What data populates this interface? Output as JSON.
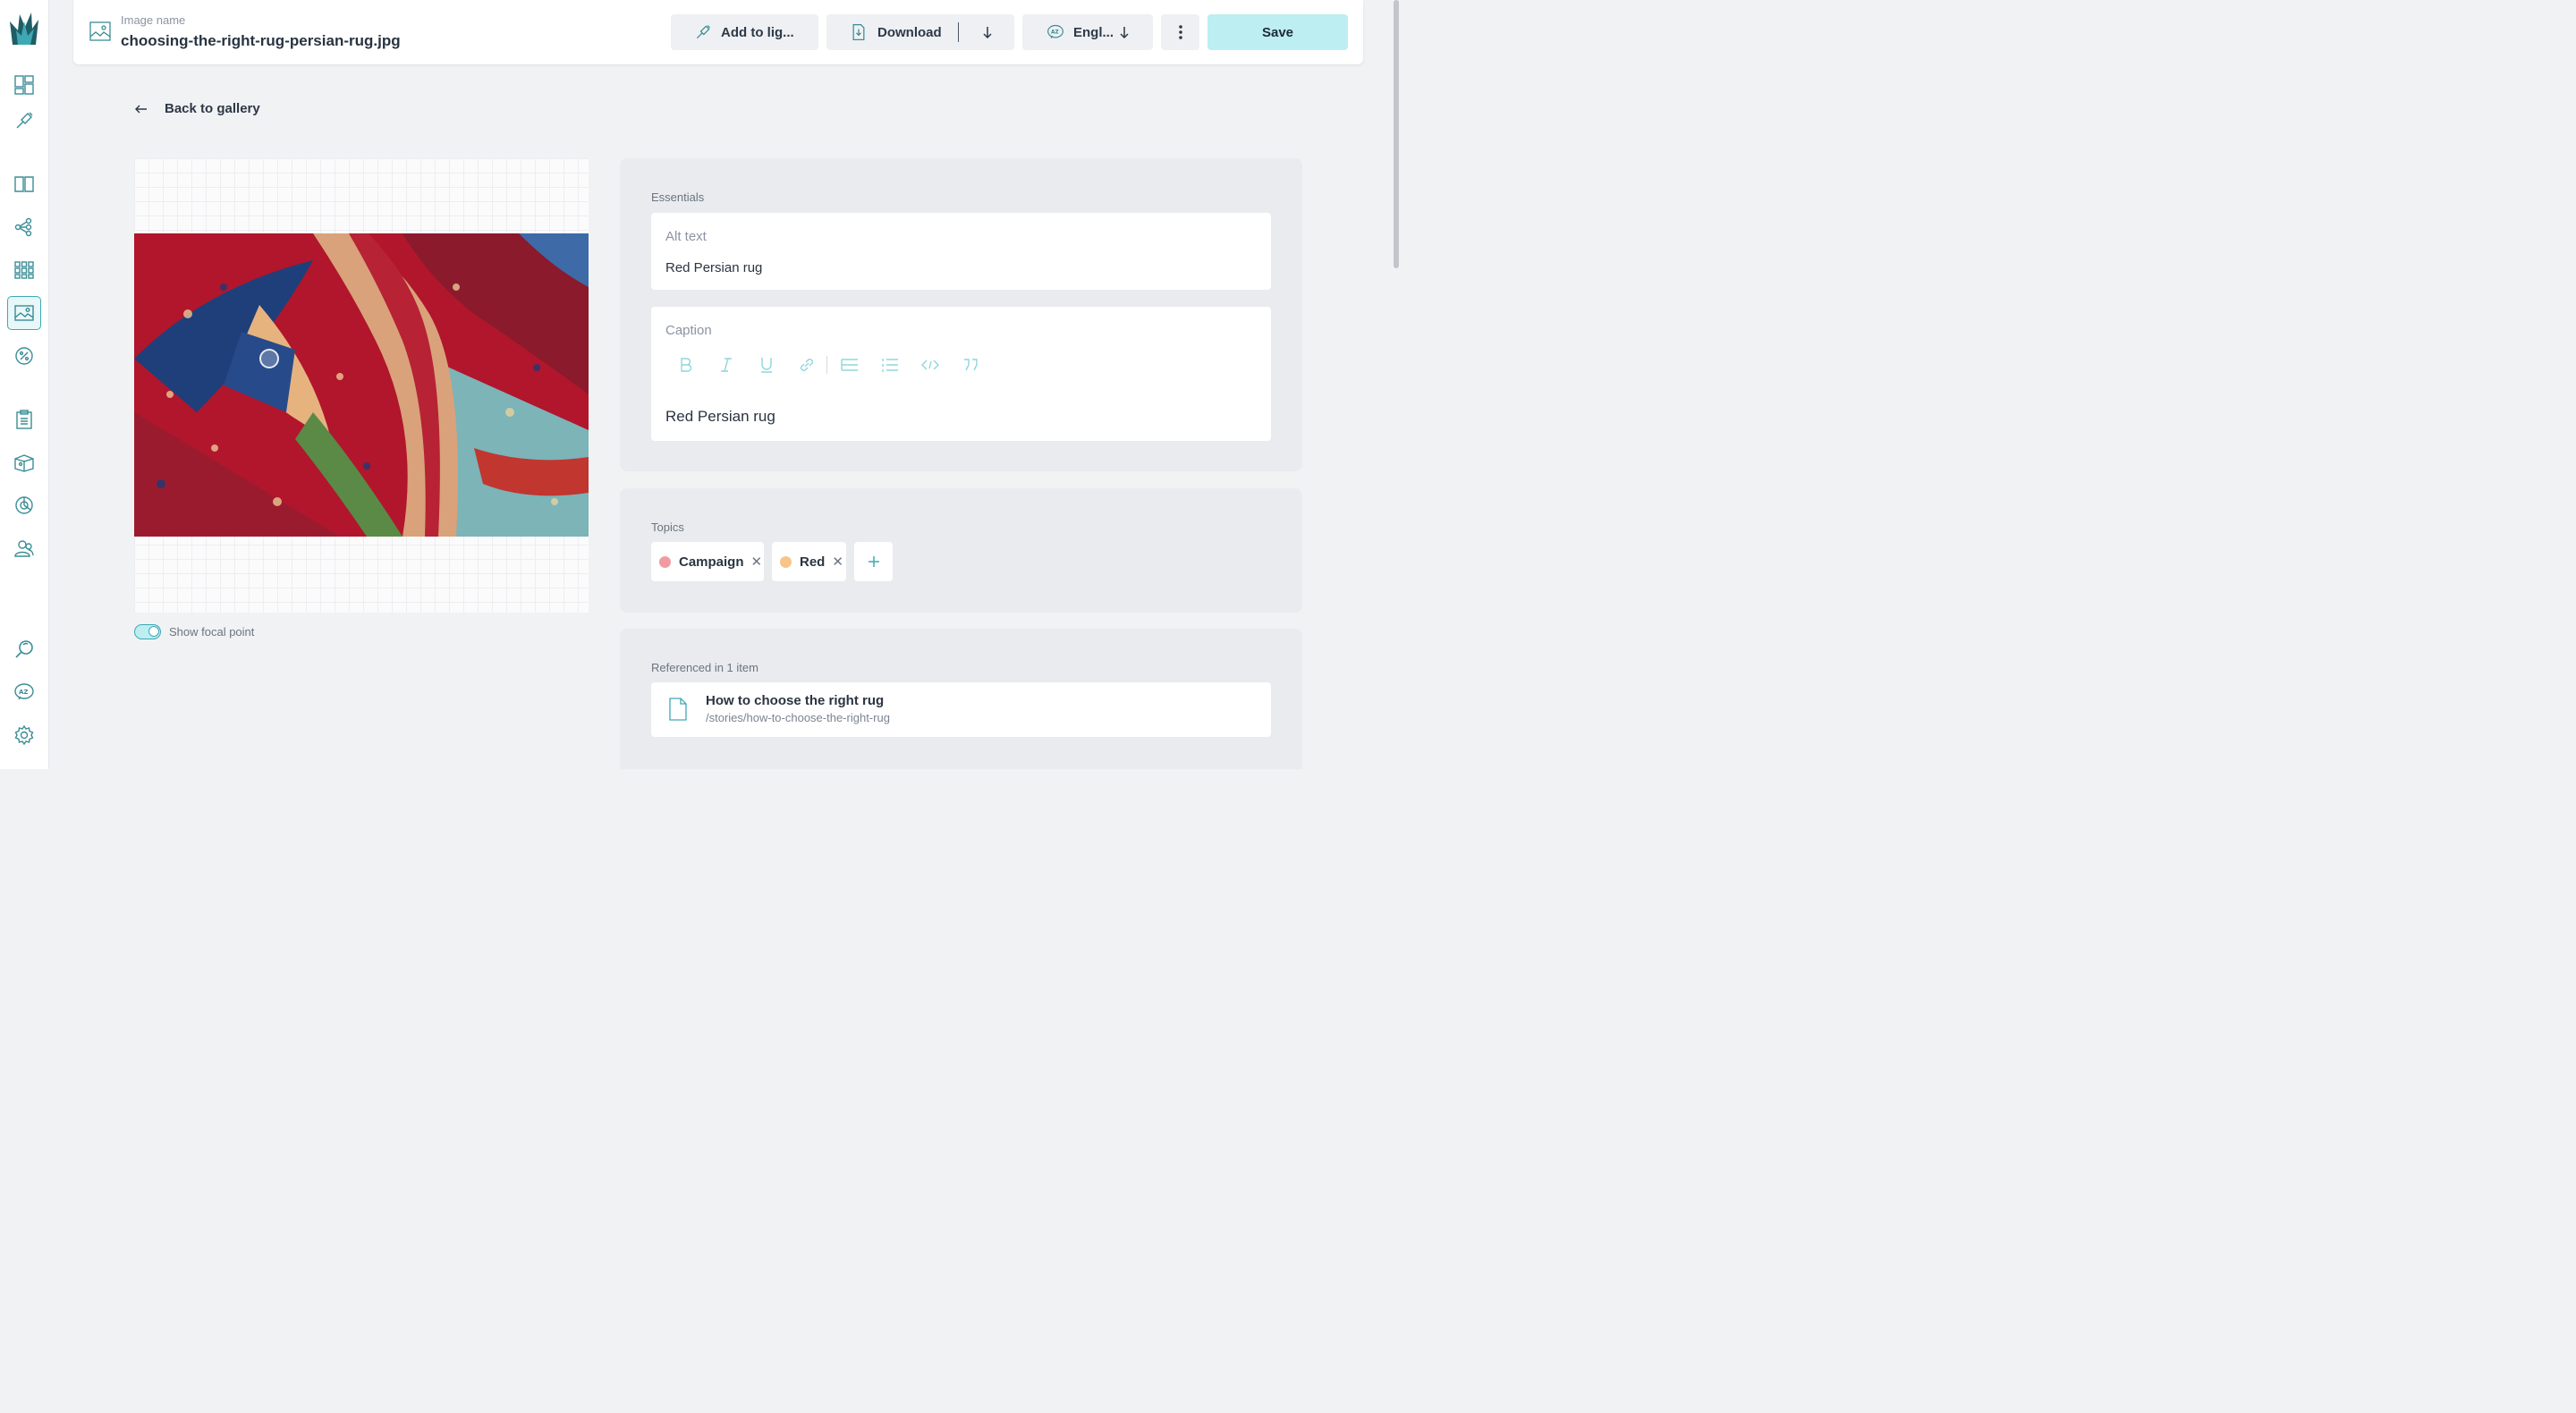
{
  "header": {
    "image_name_label": "Image name",
    "image_name": "choosing-the-right-rug-persian-rug.jpg",
    "add_to_lightbox_label": "Add to lig...",
    "download_label": "Download",
    "language_label": "Engl...",
    "save_label": "Save"
  },
  "nav": {
    "back_label": "Back to gallery"
  },
  "sidebar": {
    "items": [
      "dashboard-icon",
      "lightbox-icon",
      "book-icon",
      "hierarchy-icon",
      "grid-icon",
      "images-icon",
      "percent-icon",
      "clipboard-icon",
      "box-icon",
      "chart-icon",
      "users-icon",
      "search-icon",
      "translate-icon",
      "settings-icon"
    ],
    "active": "images-icon"
  },
  "image": {
    "focal_point_label": "Show focal point",
    "focal_point_enabled": true
  },
  "essentials": {
    "section_label": "Essentials",
    "alt_text_label": "Alt text",
    "alt_text_value": "Red Persian rug",
    "caption_label": "Caption",
    "caption_value": "Red Persian rug",
    "toolbar": [
      "bold-icon",
      "italic-icon",
      "underline-icon",
      "link-icon",
      "bullet-list-icon",
      "numbered-list-icon",
      "code-icon",
      "quote-icon"
    ]
  },
  "topics": {
    "section_label": "Topics",
    "tags": [
      {
        "label": "Campaign",
        "color": "#f19ba1"
      },
      {
        "label": "Red",
        "color": "#f7c58a"
      }
    ]
  },
  "references": {
    "section_label": "Referenced in 1 item",
    "items": [
      {
        "title": "How to choose the right rug",
        "path": "/stories/how-to-choose-the-right-rug"
      }
    ]
  },
  "colors": {
    "accent": "#3ea9b4",
    "accent_light": "#bdeef1",
    "background": "#f1f2f4"
  }
}
